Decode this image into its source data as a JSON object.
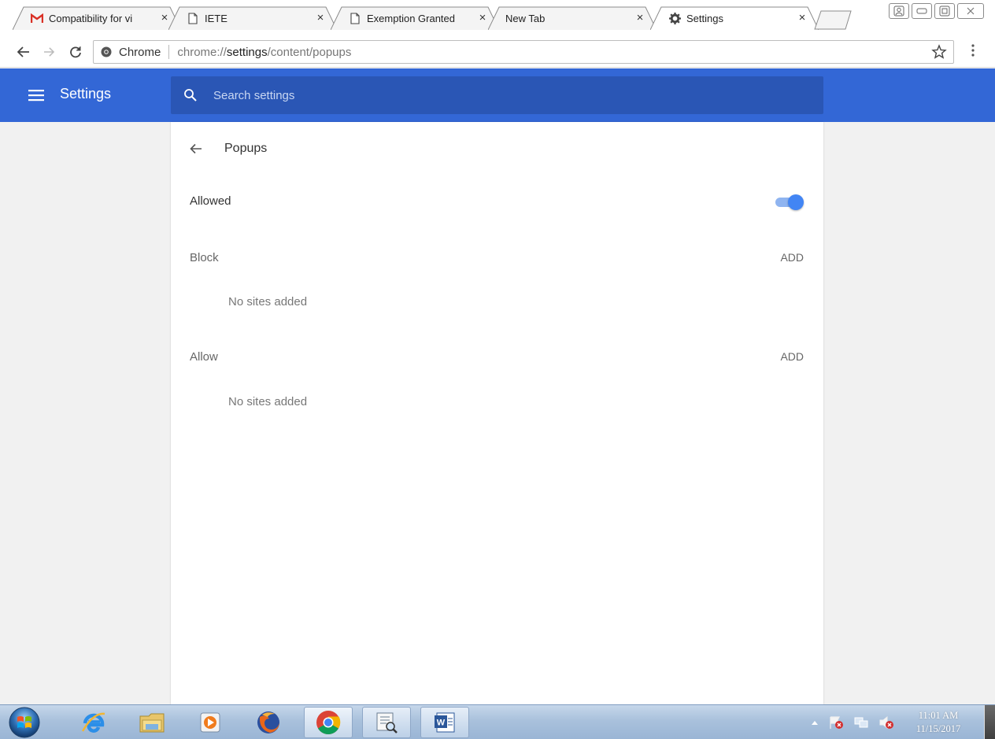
{
  "tabs": [
    {
      "title": "Compatibility for vi",
      "favicon": "gmail-icon",
      "close": "×",
      "faded": true
    },
    {
      "title": "IETE",
      "favicon": "page-icon",
      "close": "×",
      "faded": false
    },
    {
      "title": "Exemption Granted",
      "favicon": "page-icon",
      "close": "×",
      "faded": true
    },
    {
      "title": "New Tab",
      "favicon": "",
      "close": "×",
      "faded": false
    },
    {
      "title": "Settings",
      "favicon": "gear-icon",
      "close": "×",
      "faded": false
    }
  ],
  "omnibox": {
    "site_label": "Chrome",
    "url_prefix": "chrome://",
    "url_host": "settings",
    "url_path": "/content/popups"
  },
  "header": {
    "title": "Settings",
    "search_placeholder": "Search settings"
  },
  "page": {
    "title": "Popups",
    "allowed_label": "Allowed",
    "allowed_on": true,
    "block": {
      "label": "Block",
      "add_label": "ADD",
      "empty_text": "No sites added"
    },
    "allow": {
      "label": "Allow",
      "add_label": "ADD",
      "empty_text": "No sites added"
    }
  },
  "taskbar": {
    "time": "11:01 AM",
    "date": "11/15/2017"
  },
  "colors": {
    "header_blue": "#3367d6",
    "search_blue": "#2a56b5",
    "toggle_blue": "#4285f4"
  }
}
